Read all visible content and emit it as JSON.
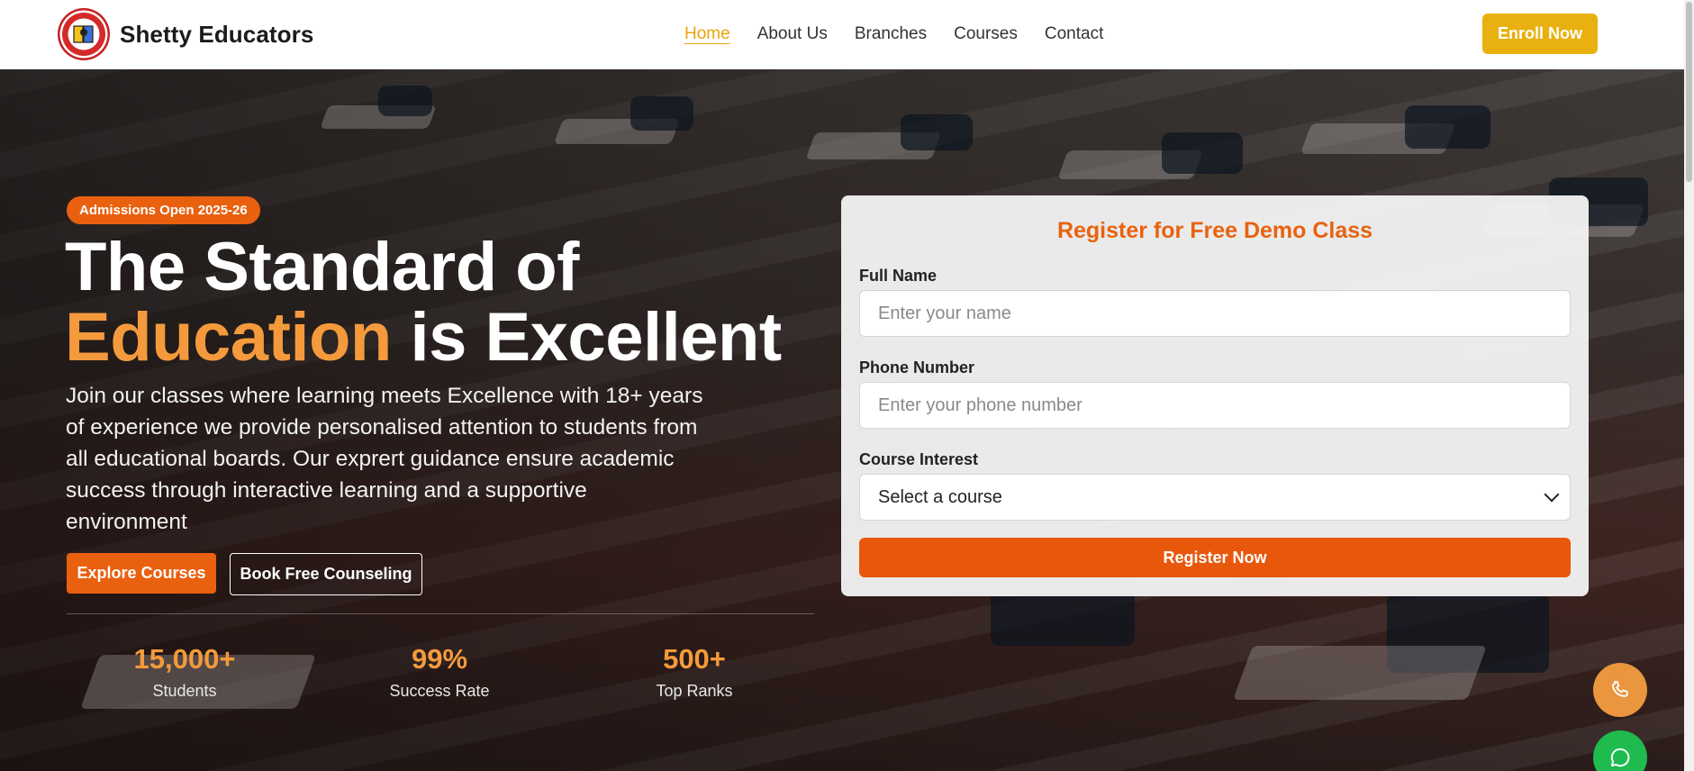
{
  "brand": {
    "name": "Shetty Educators",
    "logo_icon": "school-logo"
  },
  "nav": {
    "items": [
      {
        "label": "Home",
        "active": true
      },
      {
        "label": "About Us",
        "active": false
      },
      {
        "label": "Branches",
        "active": false
      },
      {
        "label": "Courses",
        "active": false
      },
      {
        "label": "Contact",
        "active": false
      }
    ],
    "enroll_label": "Enroll Now"
  },
  "hero": {
    "badge": "Admissions Open 2025-26",
    "headline_line1": "The Standard of",
    "headline_accent": "Education",
    "headline_rest": " is Excellent",
    "lead": "Join our classes where learning meets Excellence with 18+ years of experience we provide personalised attention to students from all educational boards. Our exprert guidance ensure academic success through interactive learning and a supportive environment",
    "primary_button": "Explore Courses",
    "secondary_button": "Book Free Counseling",
    "stats": [
      {
        "value": "15,000+",
        "label": "Students"
      },
      {
        "value": "99%",
        "label": "Success Rate"
      },
      {
        "value": "500+",
        "label": "Top Ranks"
      }
    ]
  },
  "form": {
    "title": "Register for Free Demo Class",
    "name_label": "Full Name",
    "name_placeholder": "Enter your name",
    "phone_label": "Phone Number",
    "phone_placeholder": "Enter your phone number",
    "course_label": "Course Interest",
    "course_selected": "Select a course",
    "submit_label": "Register Now"
  },
  "floating": {
    "phone_icon": "phone-icon",
    "chat_icon": "whatsapp-icon"
  },
  "colors": {
    "accent_orange": "#e9600f",
    "accent_yellow": "#e8b10f",
    "stat_orange": "#f49a3c",
    "whatsapp_green": "#1fbb4f"
  }
}
